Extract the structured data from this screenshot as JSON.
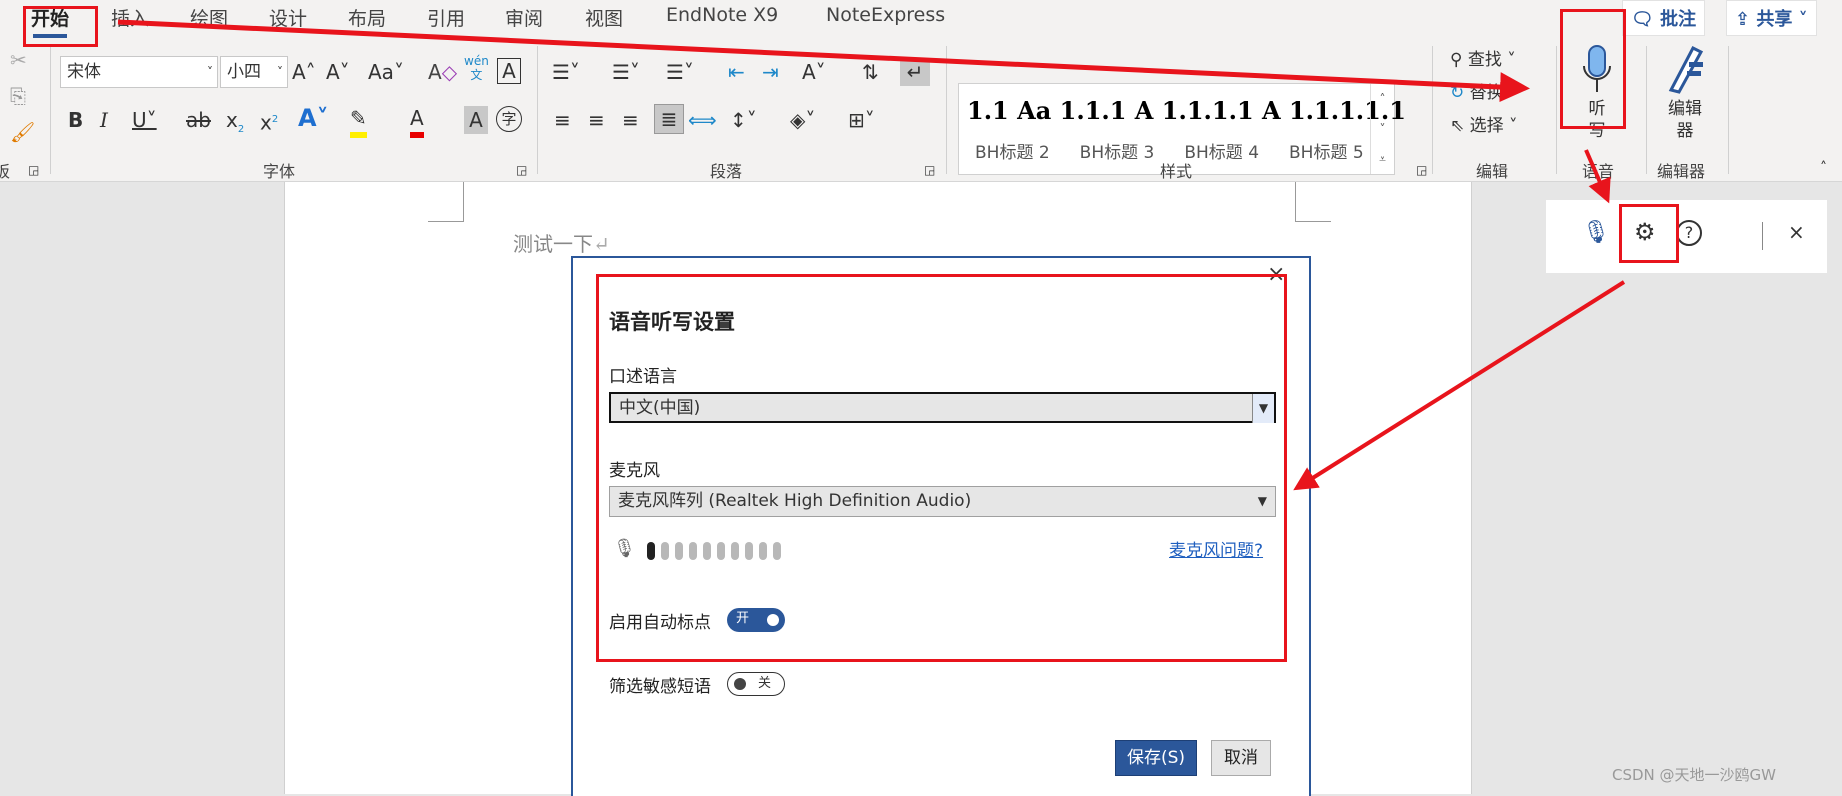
{
  "tabs": [
    "开始",
    "插入",
    "绘图",
    "设计",
    "布局",
    "引用",
    "审阅",
    "视图",
    "EndNote X9",
    "NoteExpress"
  ],
  "side_buttons": {
    "comment": "批注",
    "share": "共享"
  },
  "font": {
    "name": "宋体",
    "size": "小四",
    "group": "字体"
  },
  "paragraph": {
    "group": "段落"
  },
  "styles": {
    "preview": "1.1  Aa  1.1.1  A  1.1.1.1  A  1.1.1.1.1",
    "items": [
      "BH标题 2",
      "BH标题 3",
      "BH标题 4",
      "BH标题 5"
    ],
    "group": "样式"
  },
  "editing": {
    "find": "查找",
    "replace": "替换",
    "select": "选择",
    "group": "编辑"
  },
  "voice": {
    "dictate": "听写",
    "group": "语音"
  },
  "editor": {
    "label": "编辑器",
    "group": "编辑器"
  },
  "clipboard": {
    "group": "板"
  },
  "document": {
    "text": "测试一下"
  },
  "dictation_toolbar": {
    "close": "×"
  },
  "dialog": {
    "title": "语音听写设置",
    "language_label": "口述语言",
    "language_value": "中文(中国)",
    "mic_label": "麦克风",
    "mic_value": "麦克风阵列 (Realtek High Definition Audio)",
    "mic_level": 0.1,
    "mic_help": "麦克风问题?",
    "auto_punct_label": "启用自动标点",
    "auto_punct_state": "开",
    "filter_label": "筛选敏感短语",
    "filter_state": "关",
    "save": "保存(S)",
    "cancel": "取消",
    "close": "×"
  },
  "annotation_color": "#e8141c",
  "accent_color": "#2b579a",
  "watermark": "CSDN @天地一沙鸥GW"
}
